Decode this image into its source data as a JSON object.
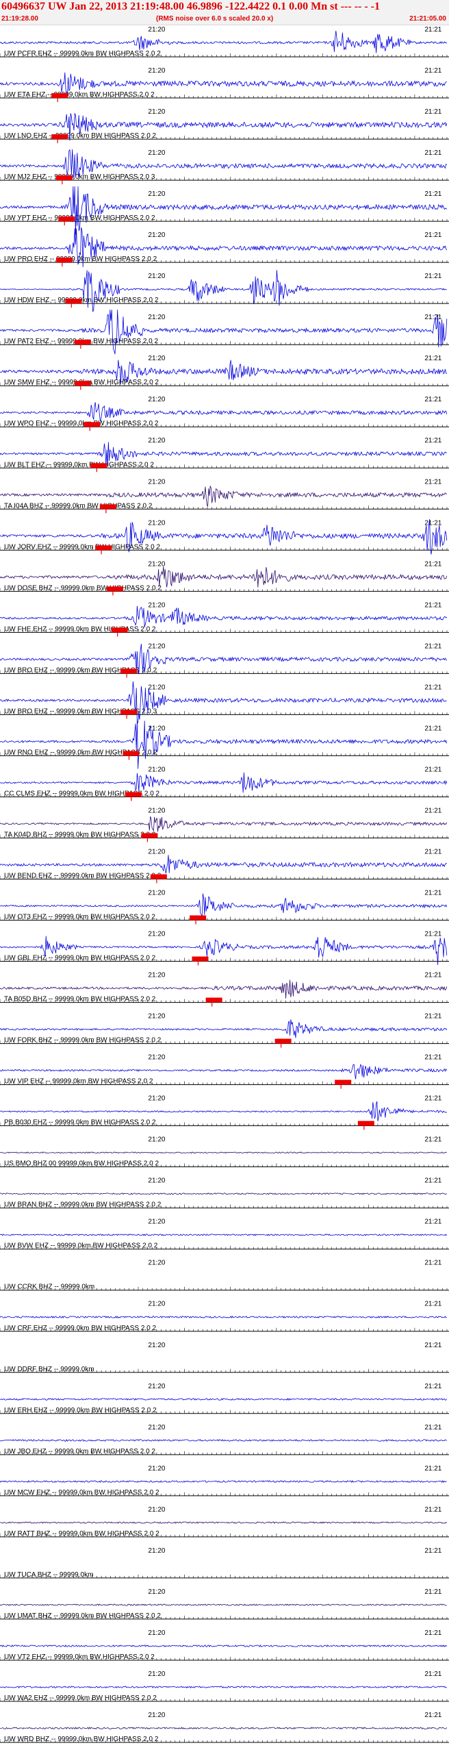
{
  "header": {
    "title": "60496637 UW Jan 22, 2013 21:19:48.00   46.9896 -122.4422  0.1 0.00 Mn st --- -- -  -1",
    "start_time": "21:19:28.00",
    "note": "(RMS noise over 6.0 s scaled 20.0 x)",
    "end_time": "21:21:05.00"
  },
  "colors": {
    "blue": "#0000dd",
    "purple": "#2a0a6a",
    "pick": "#ee0000",
    "axis": "#000000",
    "label_red": "#dd0000"
  },
  "chart_data": {
    "type": "line",
    "title": "60496637 UW Jan 22, 2013 21:19:48.00   46.9896 -122.4422  0.1 0.00 Mn st --- -- -  -1",
    "x_units": "seconds after 21:19:28.00",
    "x_range": [
      0,
      97
    ],
    "tick_labels": [
      "21:20",
      "21:21"
    ],
    "tick_times": [
      32,
      92
    ],
    "series": [
      {
        "name": "UW PCFR EHZ -- 99999.0km BW  HIGHPASS  2.0  2",
        "color": "#0000dd",
        "amp": 0.95,
        "pick": null,
        "bursts": [
          [
            30,
            1.3
          ],
          [
            73,
            2.2
          ],
          [
            82,
            2.2
          ]
        ]
      },
      {
        "name": "UW ETA EHZ -- 99999.0km BW  HIGHPASS  2.0  2",
        "color": "#0000dd",
        "amp": 1.2,
        "pick": 12.5,
        "bursts": [
          [
            14,
            2.0
          ]
        ]
      },
      {
        "name": "UW LNO EHZ -- 99999.0km BW  HIGHPASS  2.0  2",
        "color": "#0000dd",
        "amp": 1.2,
        "pick": 12.5,
        "bursts": [
          [
            15,
            2.6
          ]
        ]
      },
      {
        "name": "UW MJ2 EHZ -- 99999.0km BW  HIGHPASS  2.0  3",
        "color": "#0000dd",
        "amp": 1.0,
        "pick": 13.5,
        "bursts": [
          [
            15,
            3.0
          ]
        ]
      },
      {
        "name": "UW YPT EHZ -- 99999.0km BW  HIGHPASS  2.0  2",
        "color": "#0000dd",
        "amp": 1.1,
        "pick": 14,
        "bursts": [
          [
            16,
            5
          ]
        ]
      },
      {
        "name": "UW PRO EHZ -- 99999.0km BW  HIGHPASS  2.0  2",
        "color": "#0000dd",
        "amp": 1.0,
        "pick": 13.5,
        "bursts": [
          [
            16,
            5
          ]
        ]
      },
      {
        "name": "UW HDW EHZ -- 99999.0km BW  HIGHPASS  2.0  2",
        "color": "#0000dd",
        "amp": 0.4,
        "pick": 15.5,
        "bursts": [
          [
            19,
            5
          ],
          [
            42,
            2.5
          ],
          [
            55,
            2.5
          ],
          [
            60,
            2.5
          ]
        ]
      },
      {
        "name": "UW PAT2 EHZ -- 99999.0km BW  HIGHPASS  2.0  2",
        "color": "#0000dd",
        "amp": 0.9,
        "pick": 17.5,
        "bursts": [
          [
            24,
            5
          ],
          [
            95,
            3
          ]
        ]
      },
      {
        "name": "UW SMW EHZ -- 99999.0km BW  HIGHPASS  2.0  2",
        "color": "#0000dd",
        "amp": 1.2,
        "pick": 17.5,
        "bursts": [
          [
            26,
            2.2
          ],
          [
            50,
            1.4
          ]
        ]
      },
      {
        "name": "UW WPO EHZ -- 99999.0km BW  HIGHPASS  2.0  2",
        "color": "#0000dd",
        "amp": 0.85,
        "pick": 19.5,
        "bursts": [
          [
            20,
            1.8
          ]
        ]
      },
      {
        "name": "UW BLT EHZ -- 99999.0km BW  HIGHPASS  2.0  2",
        "color": "#0000dd",
        "amp": 0.85,
        "pick": 21,
        "bursts": [
          [
            23,
            2.0
          ]
        ]
      },
      {
        "name": "TA I04A BHZ -- 99999.0km BW  HIGHPASS  2.0  2",
        "color": "#2a0a6a",
        "amp": 1.0,
        "pick": 23,
        "bursts": [
          [
            45,
            1.5
          ]
        ]
      },
      {
        "name": "UW JORV EHZ -- 99999.0km BW  HIGHPASS  2.0  2",
        "color": "#0000dd",
        "amp": 1.1,
        "pick": 22,
        "bursts": [
          [
            28,
            2.2
          ],
          [
            58,
            2.0
          ],
          [
            93,
            3
          ]
        ]
      },
      {
        "name": "UW DOSE BHZ -- 99999.0km BW  HIGHPASS  2.0  2",
        "color": "#2a0a6a",
        "amp": 1.1,
        "pick": 24.5,
        "bursts": [
          [
            35,
            2.2
          ],
          [
            56,
            2.2
          ]
        ]
      },
      {
        "name": "UW FHE EHZ -- 99999.0km BW  HIGHPASS  2.0  2",
        "color": "#0000dd",
        "amp": 0.8,
        "pick": 25.5,
        "bursts": [
          [
            30,
            2.0
          ],
          [
            38,
            1.6
          ]
        ]
      },
      {
        "name": "UW BRO EHZ -- 99999.0km BW  HIGHPASS  2.0  2",
        "color": "#0000dd",
        "amp": 0.9,
        "pick": 27.5,
        "bursts": [
          [
            29,
            3.5
          ]
        ]
      },
      {
        "name": "UW BRO EHZ -- 99999.0km BW  HIGHPASS  2.0  3",
        "color": "#0000dd",
        "amp": 0.9,
        "pick": 27.5,
        "bursts": [
          [
            29,
            4.5
          ]
        ]
      },
      {
        "name": "UW RNO EHZ -- 99999.0km BW  HIGHPASS  2.0  2",
        "color": "#0000dd",
        "amp": 0.9,
        "pick": 28,
        "bursts": [
          [
            30,
            5
          ]
        ]
      },
      {
        "name": "CC CLMS EHZ -- 99999.0km BW  HIGHPASS  2.0  2",
        "color": "#0000dd",
        "amp": 0.7,
        "pick": 28.5,
        "bursts": [
          [
            30,
            1.8
          ],
          [
            53,
            1.8
          ]
        ]
      },
      {
        "name": "TA K04D BHZ -- 99999.0km BW  HIGHPASS  2.0  2",
        "color": "#2a0a6a",
        "amp": 0.7,
        "pick": 32,
        "bursts": [
          [
            33,
            1.6
          ]
        ]
      },
      {
        "name": "UW BEND EHZ -- 99999.0km BW  HIGHPASS  2.0  2",
        "color": "#0000dd",
        "amp": 1.0,
        "pick": 34,
        "bursts": [
          [
            36,
            1.6
          ]
        ]
      },
      {
        "name": "UW OT3 EHZ -- 99999.0km BW  HIGHPASS  2.0  2",
        "color": "#0000dd",
        "amp": 0.7,
        "pick": 42.5,
        "bursts": [
          [
            44,
            1.8
          ],
          [
            62,
            1.6
          ]
        ]
      },
      {
        "name": "UW GBL EHZ -- 99999.0km BW  HIGHPASS  2.0  2",
        "color": "#0000dd",
        "amp": 0.7,
        "pick": 43,
        "bursts": [
          [
            45,
            1.6
          ],
          [
            69,
            2.4
          ],
          [
            95,
            2.6
          ],
          [
            10,
            1.6
          ]
        ]
      },
      {
        "name": "TA B05D BHZ -- 99999.0km BW  HIGHPASS  2.0  2",
        "color": "#2a0a6a",
        "amp": 0.9,
        "pick": 46,
        "bursts": [
          [
            62,
            1.6
          ]
        ]
      },
      {
        "name": "UW FORK BHZ -- 99999.0km BW  HIGHPASS  2.0  2",
        "color": "#0000dd",
        "amp": 0.7,
        "pick": 61,
        "bursts": [
          [
            63,
            1.6
          ]
        ]
      },
      {
        "name": "UW VIP EHZ -- 99999.0km BW  HIGHPASS  2.0  2",
        "color": "#0000dd",
        "amp": 0.7,
        "pick": 74,
        "bursts": [
          [
            77,
            1.6
          ]
        ]
      },
      {
        "name": "PB B030 EHZ -- 99999.0km BW  HIGHPASS  2.0  2",
        "color": "#0000dd",
        "amp": 0.6,
        "pick": 79,
        "bursts": [
          [
            81,
            1.8
          ]
        ]
      },
      {
        "name": "US BMO BHZ 00 99999.0km BW  HIGHPASS  2.0  2",
        "color": "#2a0a6a",
        "amp": 0.5,
        "pick": null,
        "bursts": []
      },
      {
        "name": "UW BRAN BHZ -- 99999.0km BW  HIGHPASS  2.0  2",
        "color": "#2a0a6a",
        "amp": 0.6,
        "pick": null,
        "bursts": []
      },
      {
        "name": "UW BVW EHZ -- 99999.0km BW  HIGHPASS  2.0  2",
        "color": "#0000dd",
        "amp": 0.6,
        "pick": null,
        "bursts": []
      },
      {
        "name": "UW CCRK BHZ -- 99999.0km",
        "color": "#0000dd",
        "amp": 0.0,
        "pick": null,
        "bursts": []
      },
      {
        "name": "UW CRF EHZ -- 99999.0km BW  HIGHPASS  2.0  2",
        "color": "#0000dd",
        "amp": 0.7,
        "pick": null,
        "bursts": []
      },
      {
        "name": "UW DDRF BHZ -- 99999.0km",
        "color": "#0000dd",
        "amp": 0.0,
        "pick": null,
        "bursts": []
      },
      {
        "name": "UW ERH EHZ -- 99999.0km BW  HIGHPASS  2.0  2",
        "color": "#0000dd",
        "amp": 0.7,
        "pick": null,
        "bursts": []
      },
      {
        "name": "UW JBO EHZ -- 99999.0km BW  HIGHPASS  2.0  2",
        "color": "#0000dd",
        "amp": 0.7,
        "pick": null,
        "bursts": []
      },
      {
        "name": "UW MCW EHZ -- 99999.0km BW  HIGHPASS  2.0  2",
        "color": "#0000dd",
        "amp": 0.7,
        "pick": null,
        "bursts": []
      },
      {
        "name": "UW RATT BHZ -- 99999.0km BW  HIGHPASS  2.0  2",
        "color": "#2a0a6a",
        "amp": 0.6,
        "pick": null,
        "bursts": []
      },
      {
        "name": "UW TUCA BHZ -- 99999.0km",
        "color": "#2a0a6a",
        "amp": 0.0,
        "pick": null,
        "bursts": []
      },
      {
        "name": "UW UMAT BHZ -- 99999.0km BW  HIGHPASS  2.0  2",
        "color": "#2a0a6a",
        "amp": 0.6,
        "pick": null,
        "bursts": []
      },
      {
        "name": "UW VT2 EHZ -- 99999.0km BW  HIGHPASS  2.0  2",
        "color": "#0000dd",
        "amp": 0.7,
        "pick": null,
        "bursts": []
      },
      {
        "name": "UW WA2 EHZ -- 99999.0km BW  HIGHPASS  2.0  2",
        "color": "#0000dd",
        "amp": 0.7,
        "pick": null,
        "bursts": []
      },
      {
        "name": "UW WRD BHZ -- 99999.0km BW  HIGHPASS  2.0  2",
        "color": "#2a0a6a",
        "amp": 0.7,
        "pick": null,
        "bursts": []
      }
    ]
  }
}
